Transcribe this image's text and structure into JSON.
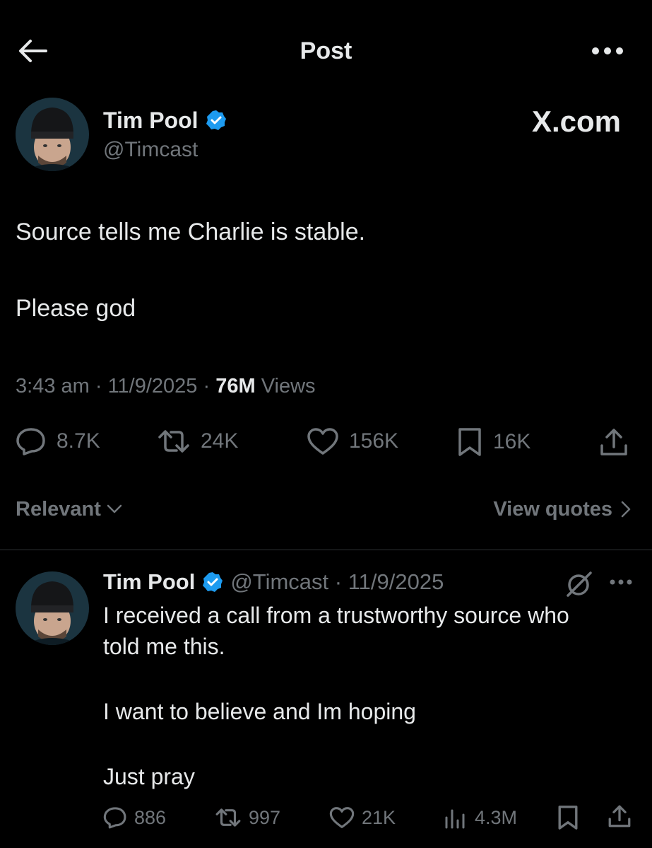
{
  "header": {
    "title": "Post"
  },
  "post": {
    "author_name": "Tim Pool",
    "author_handle": "@Timcast",
    "watermark": "X.com",
    "text_lines": [
      "Source tells me Charlie is stable.",
      "Please god"
    ],
    "time": "3:43 am",
    "date": "11/9/2025",
    "views_count": "76M",
    "views_label": "Views",
    "stats": {
      "replies": "8.7K",
      "reposts": "24K",
      "likes": "156K",
      "bookmarks": "16K"
    }
  },
  "sort": {
    "label": "Relevant",
    "view_quotes": "View quotes"
  },
  "reply": {
    "author_name": "Tim Pool",
    "handle_date": "@Timcast · 11/9/2025",
    "text": [
      "I received a call from a trustworthy source who",
      "told me this.",
      "I want to believe and Im hoping",
      "Just pray"
    ],
    "stats": {
      "replies": "886",
      "reposts": "997",
      "likes": "21K",
      "views": "4.3M"
    }
  },
  "colors": {
    "background": "#000000",
    "text": "#e7e9ea",
    "muted": "#71767b",
    "verified": "#1d9bf0",
    "divider": "#2f3336"
  }
}
